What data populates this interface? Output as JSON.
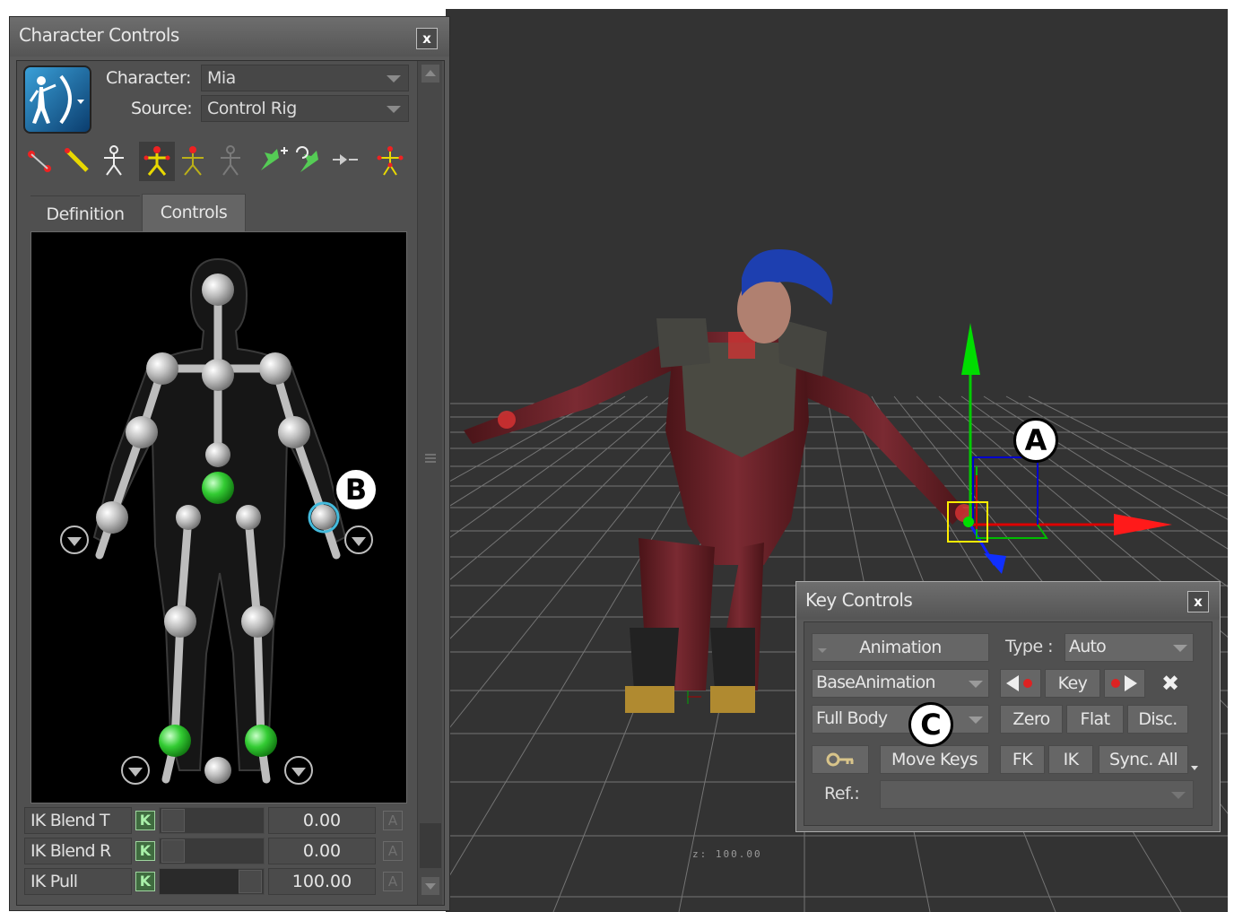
{
  "viewport": {
    "readout": "z: 100.00"
  },
  "character_controls": {
    "title": "Character Controls",
    "close_label": "x",
    "character_label": "Character:",
    "character_value": "Mia",
    "source_label": "Source:",
    "source_value": "Control Rig",
    "tabs": [
      {
        "label": "Definition",
        "active": false
      },
      {
        "label": "Controls",
        "active": true
      }
    ],
    "toolbar_icons": [
      "connect-points-icon",
      "bone-pencil-icon",
      "stick-figure-icon",
      "full-body-selected-icon",
      "body-part-icon",
      "ghost-figure-icon",
      "pin-translate-icon",
      "pin-rotate-icon",
      "release-pin-icon",
      "figure-pivot-icon"
    ],
    "ik_rows": [
      {
        "name": "IK Blend T",
        "key": "K",
        "value": "0.00",
        "fill": 0.0,
        "a": "A"
      },
      {
        "name": "IK Blend R",
        "key": "K",
        "value": "0.00",
        "fill": 0.0,
        "a": "A"
      },
      {
        "name": "IK Pull",
        "key": "K",
        "value": "100.00",
        "fill": 1.0,
        "a": "A"
      }
    ]
  },
  "key_controls": {
    "title": "Key Controls",
    "close_label": "x",
    "animation_label": "Animation",
    "type_label": "Type :",
    "type_value": "Auto",
    "layer_value": "BaseAnimation",
    "key_label": "Key",
    "delete_icon": "✖",
    "body_value": "Full Body",
    "zero_label": "Zero",
    "flat_label": "Flat",
    "disc_label": "Disc.",
    "move_keys_label": "Move Keys",
    "fk_label": "FK",
    "ik_label": "IK",
    "sync_label": "Sync. All",
    "ref_label": "Ref.:",
    "ref_value": ""
  },
  "callouts": {
    "a": "A",
    "b": "B",
    "c": "C"
  },
  "colors": {
    "panel": "#5a5a5a",
    "viewport": "#333333",
    "effector_active": "#33cc33",
    "effector_selected": "#44bbdd",
    "manip_yellow": "#ffee00"
  }
}
